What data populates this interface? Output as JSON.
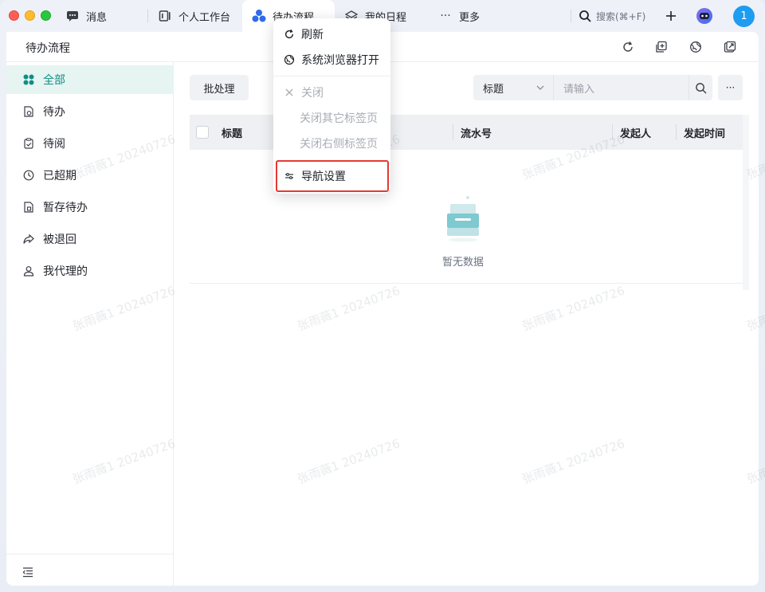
{
  "tabs": [
    {
      "label": "消息",
      "icon": "chat-icon"
    },
    {
      "label": "个人工作台",
      "icon": "workbench-icon"
    },
    {
      "label": "待办流程",
      "icon": "workflow-icon",
      "active": true
    },
    {
      "label": "我的日程",
      "icon": "layers-icon"
    },
    {
      "label": "更多",
      "icon": "more-dots-icon"
    }
  ],
  "search": {
    "label": "搜索(⌘+F)"
  },
  "user": {
    "avatar_text": "1"
  },
  "page": {
    "title": "待办流程"
  },
  "sidebar": {
    "items": [
      {
        "label": "全部",
        "icon": "grid-icon",
        "active": true
      },
      {
        "label": "待办",
        "icon": "document-clock-icon"
      },
      {
        "label": "待阅",
        "icon": "clipboard-check-icon"
      },
      {
        "label": "已超期",
        "icon": "clock-icon"
      },
      {
        "label": "暂存待办",
        "icon": "document-save-icon"
      },
      {
        "label": "被退回",
        "icon": "share-back-icon"
      },
      {
        "label": "我代理的",
        "icon": "user-icon"
      }
    ]
  },
  "toolbar": {
    "batch_label": "批处理",
    "filter_field": "标题",
    "filter_placeholder": "请输入",
    "more_label": "···"
  },
  "table": {
    "columns": [
      "标题",
      "流水号",
      "发起人",
      "发起时间"
    ],
    "empty_text": "暂无数据"
  },
  "context_menu": {
    "items": [
      {
        "label": "刷新",
        "icon": "refresh-icon",
        "disabled": false
      },
      {
        "label": "系统浏览器打开",
        "icon": "globe-icon",
        "disabled": false
      },
      {
        "label": "关闭",
        "icon": "close-icon",
        "disabled": true
      },
      {
        "label": "关闭其它标签页",
        "disabled": true
      },
      {
        "label": "关闭右侧标签页",
        "disabled": true
      },
      {
        "label": "导航设置",
        "icon": "sliders-icon",
        "disabled": false
      }
    ]
  },
  "watermark": {
    "text": "张雨薇1 20240726"
  },
  "colors": {
    "accent": "#0f8f83",
    "active_bg": "#e6f4f2",
    "highlight": "#e53a30",
    "avatar": "#1e9cf0"
  }
}
